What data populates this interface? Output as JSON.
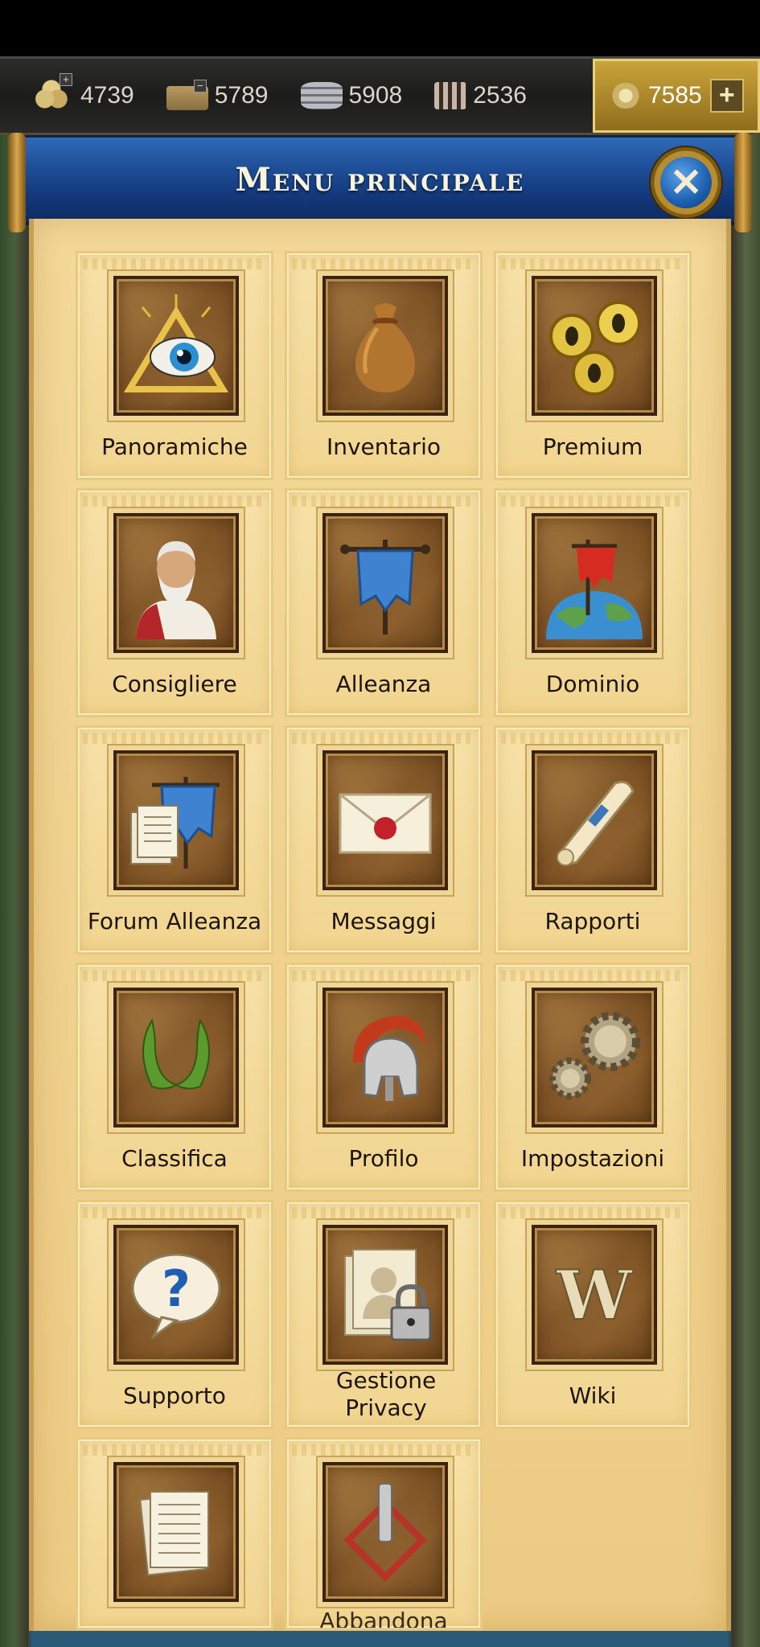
{
  "resources": {
    "wood": "4739",
    "stone": "5789",
    "silver": "5908",
    "population": "2536",
    "gold": "7585",
    "gold_plus": "+"
  },
  "header": {
    "title": "Menu principale",
    "close_glyph": "×"
  },
  "menu": {
    "items": [
      {
        "label": "Panoramiche",
        "icon": "eye-triangle-icon"
      },
      {
        "label": "Inventario",
        "icon": "sack-icon"
      },
      {
        "label": "Premium",
        "icon": "gold-coins-icon"
      },
      {
        "label": "Consigliere",
        "icon": "advisor-portrait-icon"
      },
      {
        "label": "Alleanza",
        "icon": "banner-icon"
      },
      {
        "label": "Dominio",
        "icon": "globe-banner-icon"
      },
      {
        "label": "Forum Alleanza",
        "icon": "forum-banner-icon"
      },
      {
        "label": "Messaggi",
        "icon": "envelope-icon"
      },
      {
        "label": "Rapporti",
        "icon": "scroll-icon"
      },
      {
        "label": "Classifica",
        "icon": "laurel-icon"
      },
      {
        "label": "Profilo",
        "icon": "helmet-icon"
      },
      {
        "label": "Impostazioni",
        "icon": "gears-icon"
      },
      {
        "label": "Supporto",
        "icon": "question-bubble-icon"
      },
      {
        "label": "Gestione Privacy",
        "icon": "privacy-lock-icon"
      },
      {
        "label": "Wiki",
        "icon": "wiki-w-icon"
      },
      {
        "label": "",
        "icon": "documents-icon"
      },
      {
        "label": "Abbandona",
        "icon": "power-icon"
      }
    ]
  },
  "colors": {
    "header_blue": "#1d4b94",
    "parchment": "#f0d28f",
    "icon_brown": "#7d5224"
  }
}
